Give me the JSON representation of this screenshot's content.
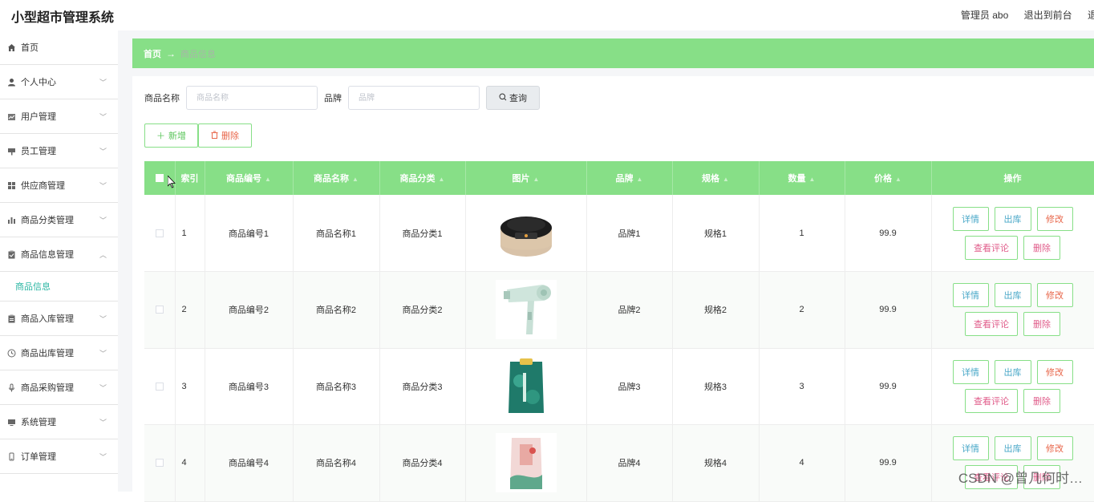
{
  "header": {
    "app_title": "小型超市管理系统",
    "admin_label": "管理员 abo",
    "front_link": "退出到前台",
    "exit_link": "退"
  },
  "sidebar": {
    "items": [
      {
        "label": "首页",
        "icon": "home-icon"
      },
      {
        "label": "个人中心",
        "icon": "user-icon"
      },
      {
        "label": "用户管理",
        "icon": "chart-icon"
      },
      {
        "label": "员工管理",
        "icon": "sign-icon"
      },
      {
        "label": "供应商管理",
        "icon": "grid-icon"
      },
      {
        "label": "商品分类管理",
        "icon": "bars-icon"
      },
      {
        "label": "商品信息管理",
        "icon": "clipboard-icon"
      },
      {
        "label": "商品入库管理",
        "icon": "doc-icon"
      },
      {
        "label": "商品出库管理",
        "icon": "clock-icon"
      },
      {
        "label": "商品采购管理",
        "icon": "mic-icon"
      },
      {
        "label": "系统管理",
        "icon": "monitor-icon"
      },
      {
        "label": "订单管理",
        "icon": "phone-icon"
      }
    ],
    "sub_item": "商品信息"
  },
  "breadcrumb": {
    "home": "首页",
    "arrow": "→",
    "current": "商品信息"
  },
  "search": {
    "name_label": "商品名称",
    "name_placeholder": "商品名称",
    "brand_label": "品牌",
    "brand_placeholder": "品牌",
    "query_button": "查询"
  },
  "actions": {
    "add": "新增",
    "delete": "删除"
  },
  "table": {
    "columns": [
      "索引",
      "商品编号",
      "商品名称",
      "商品分类",
      "图片",
      "品牌",
      "规格",
      "数量",
      "价格",
      "操作"
    ],
    "rows": [
      {
        "index": "1",
        "code": "商品编号1",
        "name": "商品名称1",
        "category": "商品分类1",
        "image": "rice-cooker",
        "brand": "品牌1",
        "spec": "规格1",
        "qty": "1",
        "price": "99.9"
      },
      {
        "index": "2",
        "code": "商品编号2",
        "name": "商品名称2",
        "category": "商品分类2",
        "image": "hair-dryer",
        "brand": "品牌2",
        "spec": "规格2",
        "qty": "2",
        "price": "99.9"
      },
      {
        "index": "3",
        "code": "商品编号3",
        "name": "商品名称3",
        "category": "商品分类3",
        "image": "rice-bag-green",
        "brand": "品牌3",
        "spec": "规格3",
        "qty": "3",
        "price": "99.9"
      },
      {
        "index": "4",
        "code": "商品编号4",
        "name": "商品名称4",
        "category": "商品分类4",
        "image": "rice-bag-pink",
        "brand": "品牌4",
        "spec": "规格4",
        "qty": "4",
        "price": "99.9"
      }
    ],
    "ops": {
      "detail": "详情",
      "out": "出库",
      "edit": "修改",
      "review": "查看评论",
      "delete": "删除"
    }
  },
  "watermark": "CSDN @曾几何时…",
  "colors": {
    "accent_green": "#87df87",
    "teal": "#2bb6a3",
    "danger": "#e8664a"
  }
}
